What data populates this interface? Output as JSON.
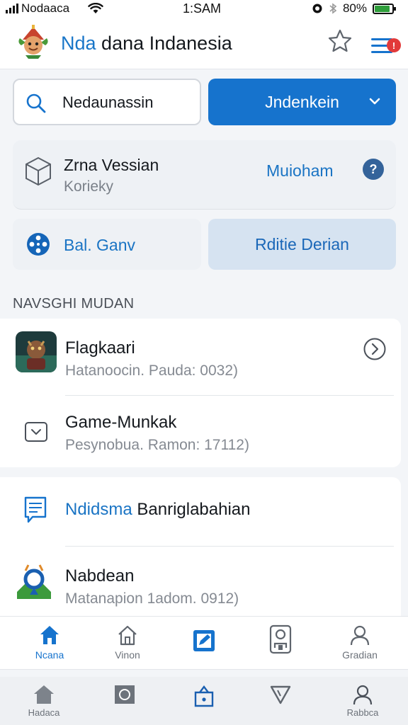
{
  "status_bar": {
    "carrier": "Nodaaca",
    "time": "1:SAM",
    "battery": "80%"
  },
  "header": {
    "title_accent": "Nda",
    "title_rest": "dana Indanesia",
    "notification_count": "!"
  },
  "search": {
    "value": "Nedaunassin"
  },
  "primary_button": {
    "label": "Jndenkein"
  },
  "version_card": {
    "title": "Zrna Vessian",
    "subtitle": "Korieky",
    "link": "Muioham"
  },
  "chips": {
    "left_label": "Bal. Ganv",
    "right_label": "Rditie Derian"
  },
  "section": {
    "label": "NAVSGHI MUDAN"
  },
  "list1": [
    {
      "title": "Flagkaari",
      "subtitle": "Hatanoocin. Pauda: 0032)"
    },
    {
      "title": "Game-Munkak",
      "subtitle": "Pesynobua. Ramon: 17112)"
    }
  ],
  "list2": [
    {
      "title_blue": "Ndidsma",
      "title_rest": "Banriglabahian"
    },
    {
      "title": "Nabdean",
      "subtitle": "Matanapion 1adom. 0912)"
    }
  ],
  "tabs": [
    {
      "label": "Ncana",
      "icon": "home-icon"
    },
    {
      "label": "Vinon",
      "icon": "house-outline-icon"
    },
    {
      "label": "",
      "icon": "edit-square-icon"
    },
    {
      "label": "",
      "icon": "person-badge-icon"
    },
    {
      "label": "Gradian",
      "icon": "user-icon"
    }
  ],
  "system_bar": [
    {
      "label": "Hadaca",
      "icon": "home-icon"
    },
    {
      "label": "",
      "icon": "square-icon"
    },
    {
      "label": "",
      "icon": "bag-icon"
    },
    {
      "label": "",
      "icon": "triangle-icon"
    },
    {
      "label": "Rabbca",
      "icon": "profile-icon"
    }
  ],
  "colors": {
    "accent": "#1673cd",
    "notification": "#e23a3a",
    "battery": "#2e9e3a"
  }
}
